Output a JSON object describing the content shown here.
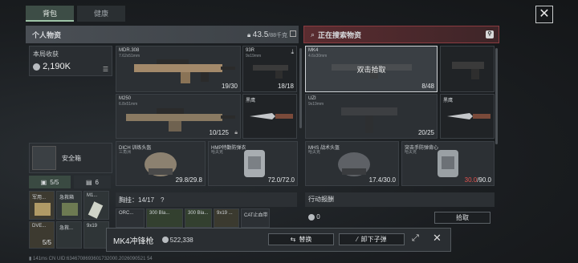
{
  "tabs": [
    {
      "label": "背包"
    },
    {
      "label": "健康"
    }
  ],
  "left_panel": {
    "title": "个人物资",
    "weight": "43.5",
    "weight_max": "/88千克",
    "harvest_label": "本局收获",
    "harvest_value": "2,190K",
    "safebox_label": "安全箱",
    "count_tab_1": "5/5",
    "count_tab_2": "6"
  },
  "right_panel": {
    "title": "正在搜索物资"
  },
  "left_slots": [
    {
      "name": "MDR.308",
      "sub": "7.62x51mm",
      "count": "19/30"
    },
    {
      "name": "93R",
      "sub": "9x19mm",
      "count": "18/18"
    },
    {
      "name": "M250",
      "sub": "6.8x51mm",
      "count": "10/125"
    },
    {
      "name": "黑鹰",
      "sub": "",
      "count": ""
    },
    {
      "name": "DICH 训练头盔",
      "sub": "三角洲",
      "count": "29.8/29.8"
    },
    {
      "name": "HMP特勤防弹衣",
      "sub": "哈夫克",
      "count": "72.0/72.0"
    }
  ],
  "right_slots": [
    {
      "name": "MK4",
      "sub": "4.6x30mm",
      "count": "8/48",
      "overlay": "双击拾取"
    },
    {
      "name": "UZI",
      "sub": "9x19mm",
      "count": "20/25"
    },
    {
      "name": "黑鹰",
      "sub": "",
      "count": ""
    },
    {
      "name": "MHS 战术头盔",
      "sub": "哈夫克",
      "count": "17.4/30.0"
    },
    {
      "name": "突击手防弹背心",
      "sub": "哈夫克",
      "count_red": "30.0",
      "count_rest": "/90.0"
    }
  ],
  "chest": {
    "label": "胸挂：",
    "value": "14/17",
    "help": "?"
  },
  "action": {
    "title": "行动报酬",
    "value": "0",
    "pickup": "拾取"
  },
  "pocket_items": [
    {
      "name": "军用...",
      "count": ""
    },
    {
      "name": "急救箱",
      "count": ""
    },
    {
      "name": "M1...",
      "count": ""
    },
    {
      "name": "DVE...",
      "count": "5/5"
    },
    {
      "name": "急救...",
      "count": ""
    },
    {
      "name": "9x19",
      "count": ""
    }
  ],
  "chest_items": [
    {
      "name": "ORC..."
    },
    {
      "name": "300 Bla..."
    },
    {
      "name": "300 Bla..."
    },
    {
      "name": "9x19 ..."
    },
    {
      "name": "CAT止血带"
    }
  ],
  "bottombar": {
    "item_name": "MK4冲锋枪",
    "price": "522,338",
    "swap_label": "替换",
    "unload_label": "卸下子弹"
  },
  "footer": "141ms  CN UID:6346708693601732000.2026090521 54",
  "colors": {
    "accent_green": "#9ec3a6",
    "accent_red": "#8a3b40",
    "warn_red": "#e0524f"
  }
}
